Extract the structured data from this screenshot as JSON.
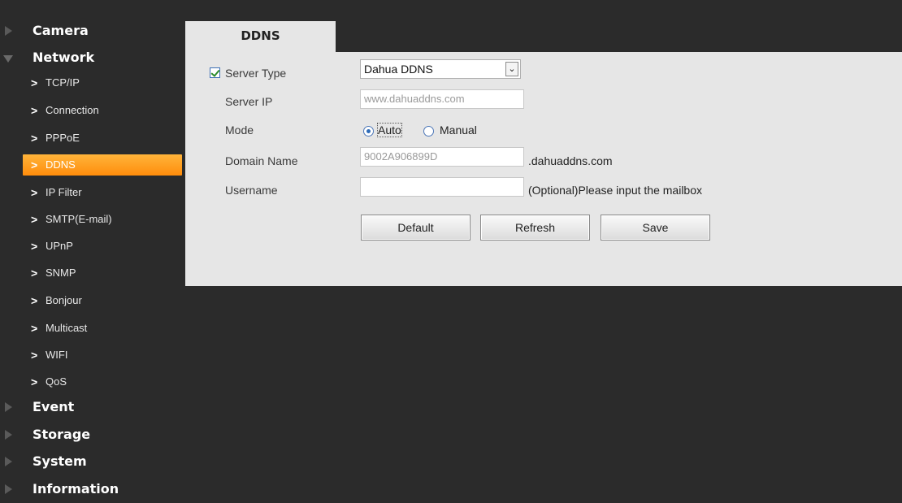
{
  "sidebar": {
    "categories": {
      "camera": "Camera",
      "network": "Network",
      "event": "Event",
      "storage": "Storage",
      "system": "System",
      "information": "Information"
    },
    "network_items": [
      {
        "label": "TCP/IP"
      },
      {
        "label": "Connection"
      },
      {
        "label": "PPPoE"
      },
      {
        "label": "DDNS"
      },
      {
        "label": "IP Filter"
      },
      {
        "label": "SMTP(E-mail)"
      },
      {
        "label": "UPnP"
      },
      {
        "label": "SNMP"
      },
      {
        "label": "Bonjour"
      },
      {
        "label": "Multicast"
      },
      {
        "label": "WIFI"
      },
      {
        "label": "QoS"
      }
    ],
    "active_item": "DDNS",
    "chevron": ">"
  },
  "tab": {
    "title": "DDNS"
  },
  "form": {
    "server_type": {
      "label": "Server Type",
      "checked": true,
      "value": "Dahua DDNS",
      "arrow": "⌄"
    },
    "server_ip": {
      "label": "Server IP",
      "value": "www.dahuaddns.com"
    },
    "mode": {
      "label": "Mode",
      "options": [
        "Auto",
        "Manual"
      ],
      "selected": "Auto"
    },
    "domain_name": {
      "label": "Domain Name",
      "value": "9002A906899D",
      "suffix": ".dahuaddns.com"
    },
    "username": {
      "label": "Username",
      "value": "",
      "hint": "(Optional)Please input the mailbox"
    }
  },
  "buttons": {
    "default": "Default",
    "refresh": "Refresh",
    "save": "Save"
  },
  "colors": {
    "background": "#2b2b2b",
    "panel": "#e6e6e6",
    "active_gradient_top": "#ffb43a",
    "active_gradient_bottom": "#ff8d0c"
  },
  "icons": {
    "collapsed": "triangle-right-icon",
    "expanded": "triangle-down-icon",
    "item": "chevron-right-icon"
  }
}
